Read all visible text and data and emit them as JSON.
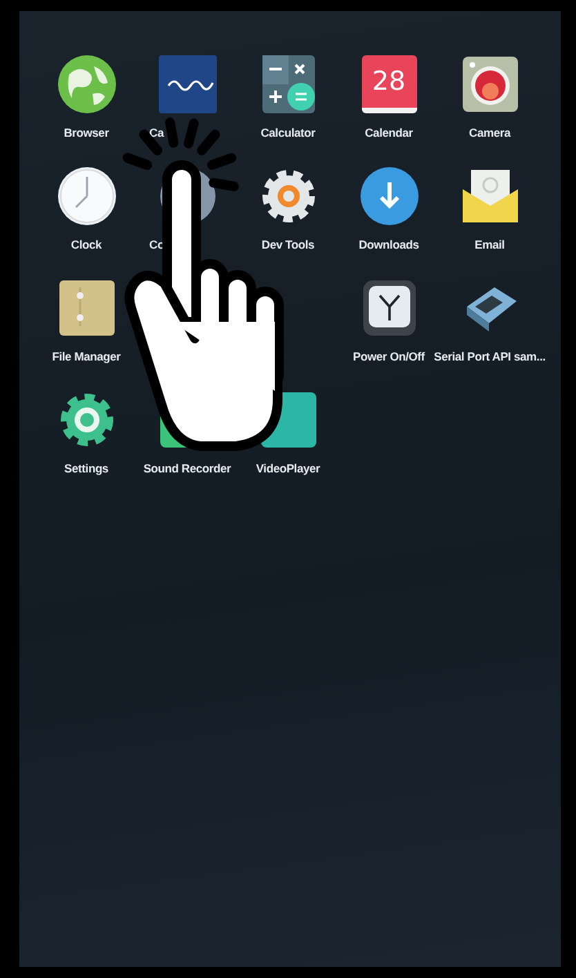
{
  "apps": [
    {
      "kind": "globe",
      "label": "Browser"
    },
    {
      "kind": "brand",
      "label": "Ca",
      "cut": true
    },
    {
      "kind": "calculator",
      "label": "Calculator"
    },
    {
      "kind": "calendar",
      "label": "Calendar",
      "badge": "28"
    },
    {
      "kind": "camera",
      "label": "Camera"
    },
    {
      "kind": "clock",
      "label": "Clock"
    },
    {
      "kind": "contacts",
      "label": "Co",
      "cut": true
    },
    {
      "kind": "gear",
      "label": "Dev Tools"
    },
    {
      "kind": "download",
      "label": "Downloads"
    },
    {
      "kind": "email",
      "label": "Email"
    },
    {
      "kind": "folder",
      "label": "File Manager"
    },
    {
      "kind": "covered"
    },
    {
      "kind": "covered"
    },
    {
      "kind": "alarm",
      "label": "Power On/Off"
    },
    {
      "kind": "serial",
      "label": "Serial Port API sam..."
    },
    {
      "kind": "settings",
      "label": "Settings"
    },
    {
      "kind": "recorder",
      "label": "Sound Recorder"
    },
    {
      "kind": "video",
      "label": "VideoPlayer"
    }
  ]
}
